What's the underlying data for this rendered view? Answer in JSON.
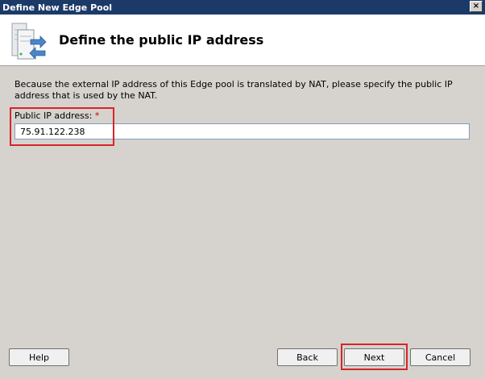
{
  "window": {
    "title": "Define New Edge Pool",
    "close_glyph": "×"
  },
  "header": {
    "heading": "Define the public IP address",
    "icon": "server-network-icon"
  },
  "main": {
    "description": "Because the external IP address of this Edge pool is translated by NAT, please specify the public IP address that is used by the NAT.",
    "ip_label": "Public IP address:",
    "required_marker": "*",
    "ip_value": "75.91.122.238"
  },
  "footer": {
    "help_label": "Help",
    "back_label": "Back",
    "next_label": "Next",
    "cancel_label": "Cancel"
  },
  "colors": {
    "titlebar": "#1b3a68",
    "highlight": "#d6252a",
    "required": "#cc0000",
    "background": "#d6d3ce"
  }
}
